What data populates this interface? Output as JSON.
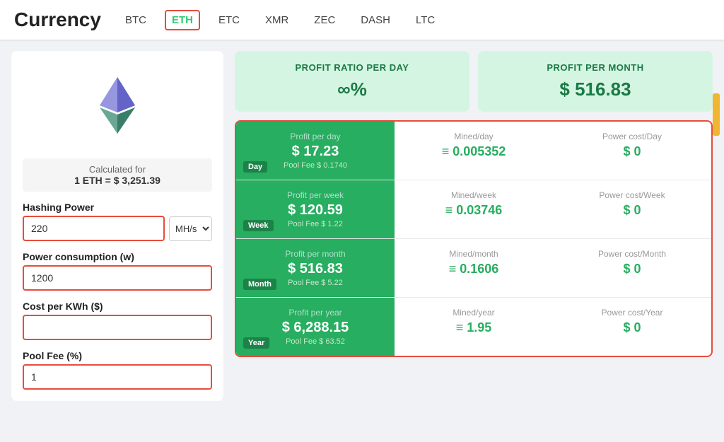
{
  "header": {
    "title": "Currency",
    "tabs": [
      {
        "label": "BTC",
        "active": false
      },
      {
        "label": "ETH",
        "active": true
      },
      {
        "label": "ETC",
        "active": false
      },
      {
        "label": "XMR",
        "active": false
      },
      {
        "label": "ZEC",
        "active": false
      },
      {
        "label": "DASH",
        "active": false
      },
      {
        "label": "LTC",
        "active": false
      }
    ]
  },
  "left_panel": {
    "calculated_for_label": "Calculated for",
    "eth_price": "1 ETH = $ 3,251.39",
    "hashing_power_label": "Hashing Power",
    "hashing_power_value": "220",
    "hashing_power_unit": "MH/s",
    "power_consumption_label": "Power consumption (w)",
    "power_consumption_value": "1200",
    "cost_per_kwh_label": "Cost per KWh ($)",
    "cost_per_kwh_value": "",
    "pool_fee_label": "Pool Fee (%)",
    "pool_fee_value": "1"
  },
  "summary": {
    "profit_ratio_label": "PROFIT RATIO PER DAY",
    "profit_ratio_value": "∞%",
    "profit_month_label": "PROFIT PER MONTH",
    "profit_month_value": "$ 516.83"
  },
  "results": [
    {
      "period": "Day",
      "profit_label": "Profit per day",
      "profit_value": "$ 17.23",
      "pool_fee": "Pool Fee $ 0.1740",
      "mined_label": "Mined/day",
      "mined_value": "≡ 0.005352",
      "power_label": "Power cost/Day",
      "power_value": "$ 0"
    },
    {
      "period": "Week",
      "profit_label": "Profit per week",
      "profit_value": "$ 120.59",
      "pool_fee": "Pool Fee $ 1.22",
      "mined_label": "Mined/week",
      "mined_value": "≡ 0.03746",
      "power_label": "Power cost/Week",
      "power_value": "$ 0"
    },
    {
      "period": "Month",
      "profit_label": "Profit per month",
      "profit_value": "$ 516.83",
      "pool_fee": "Pool Fee $ 5.22",
      "mined_label": "Mined/month",
      "mined_value": "≡ 0.1606",
      "power_label": "Power cost/Month",
      "power_value": "$ 0"
    },
    {
      "period": "Year",
      "profit_label": "Profit per year",
      "profit_value": "$ 6,288.15",
      "pool_fee": "Pool Fee $ 63.52",
      "mined_label": "Mined/year",
      "mined_value": "≡ 1.95",
      "power_label": "Power cost/Year",
      "power_value": "$ 0"
    }
  ]
}
